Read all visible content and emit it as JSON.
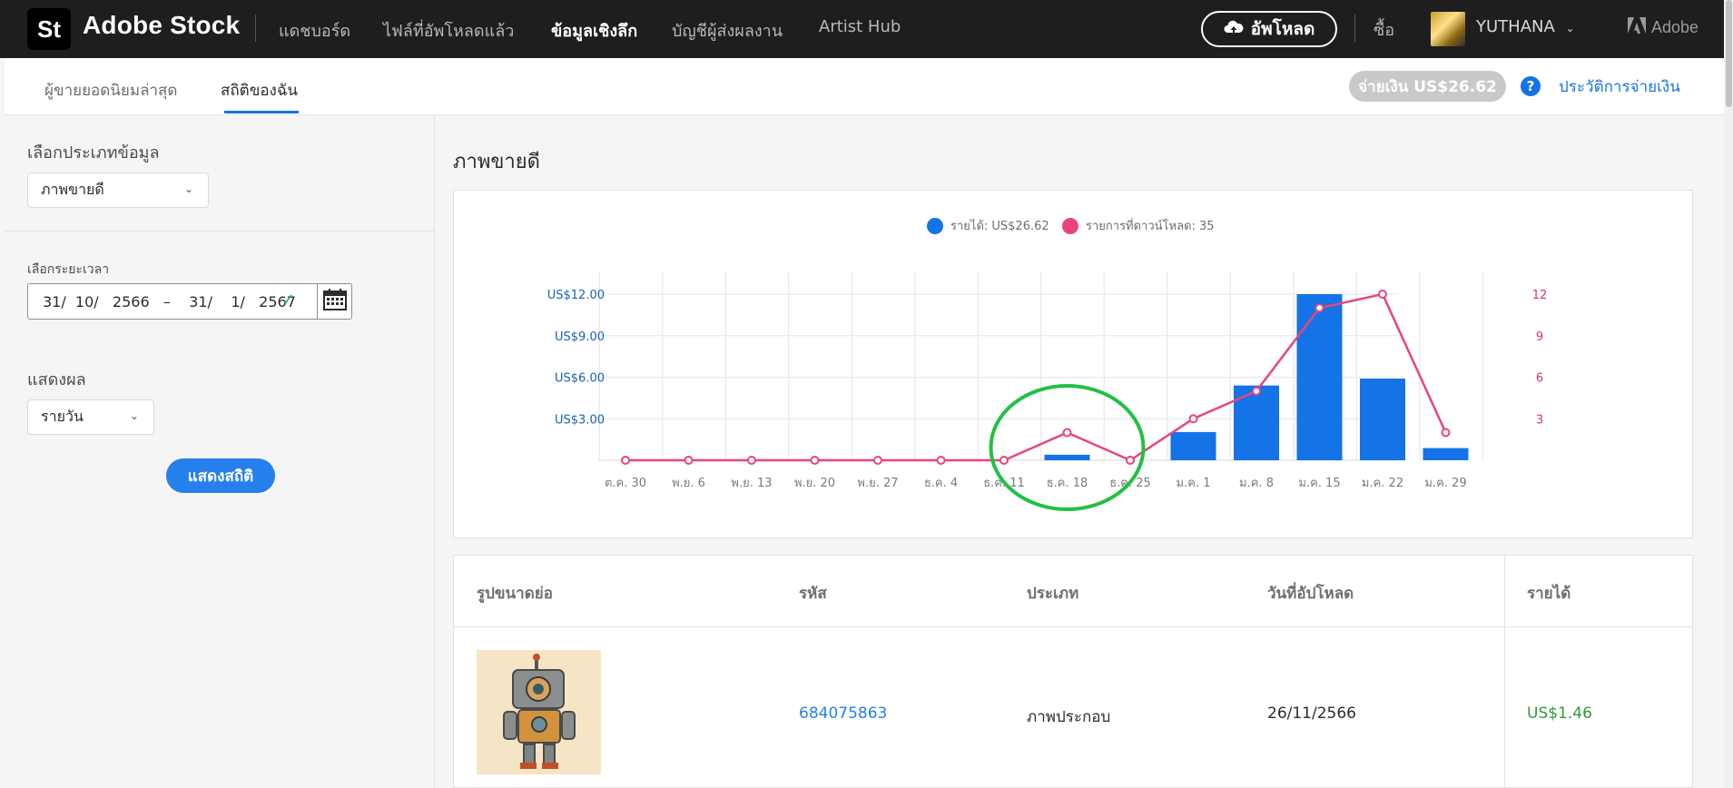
{
  "header": {
    "logo_text": "St",
    "brand": "Adobe Stock",
    "nav": [
      {
        "label": "แดชบอร์ด",
        "active": false
      },
      {
        "label": "ไฟล์ที่อัพโหลดแล้ว",
        "active": false
      },
      {
        "label": "ข้อมูลเชิงลึก",
        "active": true
      },
      {
        "label": "บัญชีผู้ส่งผลงาน",
        "active": false
      },
      {
        "label": "Artist Hub",
        "active": false
      }
    ],
    "upload_label": "อัพโหลด",
    "buy_label": "ซื้อ",
    "username": "YUTHANA",
    "adobe_label": "Adobe"
  },
  "subnav": {
    "tabs": [
      {
        "label": "ผู้ขายยอดนิยมล่าสุด",
        "active": false
      },
      {
        "label": "สถิติของฉัน",
        "active": true
      }
    ],
    "payout_label": "จ่ายเงิน US$26.62",
    "help_glyph": "?",
    "payout_history_label": "ประวัติการจ่ายเงิน"
  },
  "sidebar": {
    "data_type_label": "เลือกประเภทข้อมูล",
    "data_type_value": "ภาพขายดี",
    "date_range_label": "เลือกระยะเวลา",
    "date_range_value": "31/  10/   2566   –    31/    1/   2567",
    "display_label": "แสดงผล",
    "display_value": "รายวัน",
    "show_button_label": "แสดงสถิติ"
  },
  "main": {
    "title": "ภาพขายดี"
  },
  "colors": {
    "revenue": "#1473e6",
    "downloads": "#e8457c",
    "annotation": "#22c044"
  },
  "chart_data": {
    "type": "bar",
    "categories": [
      "ต.ค. 30",
      "พ.ย. 6",
      "พ.ย. 13",
      "พ.ย. 20",
      "พ.ย. 27",
      "ธ.ค. 4",
      "ธ.ค. 11",
      "ธ.ค. 18",
      "ธ.ค. 25",
      "ม.ค. 1",
      "ม.ค. 8",
      "ม.ค. 15",
      "ม.ค. 22",
      "ม.ค. 29"
    ],
    "series": [
      {
        "name": "รายได้: US$26.62",
        "type": "bar",
        "axis": "left",
        "values": [
          0,
          0,
          0,
          0,
          0,
          0,
          0,
          0.4,
          0,
          2.04,
          5.4,
          12.0,
          5.9,
          0.88
        ]
      },
      {
        "name": "รายการที่ดาวน์โหลด: 35",
        "type": "line",
        "axis": "right",
        "values": [
          0,
          0,
          0,
          0,
          0,
          0,
          0,
          2,
          0,
          3,
          5,
          11,
          12,
          2
        ]
      }
    ],
    "left_axis": {
      "ticks": [
        "US$3.00",
        "US$6.00",
        "US$9.00",
        "US$12.00"
      ],
      "tick_values": [
        3,
        6,
        9,
        12
      ],
      "ylim": [
        0,
        12
      ]
    },
    "right_axis": {
      "ticks": [
        "3",
        "6",
        "9",
        "12"
      ],
      "tick_values": [
        3,
        6,
        9,
        12
      ],
      "ylim": [
        0,
        12
      ]
    },
    "grid": true,
    "legend": "top-center",
    "annotation": {
      "type": "ellipse",
      "around": "ธ.ค. 18"
    }
  },
  "table": {
    "headers": [
      "รูปขนาดย่อ",
      "รหัส",
      "ประเภท",
      "วันที่อัปโหลด",
      "รายได้"
    ],
    "rows": [
      {
        "id": "684075863",
        "type": "ภาพประกอบ",
        "upload_date": "26/11/2566",
        "earnings": "US$1.46"
      }
    ]
  }
}
